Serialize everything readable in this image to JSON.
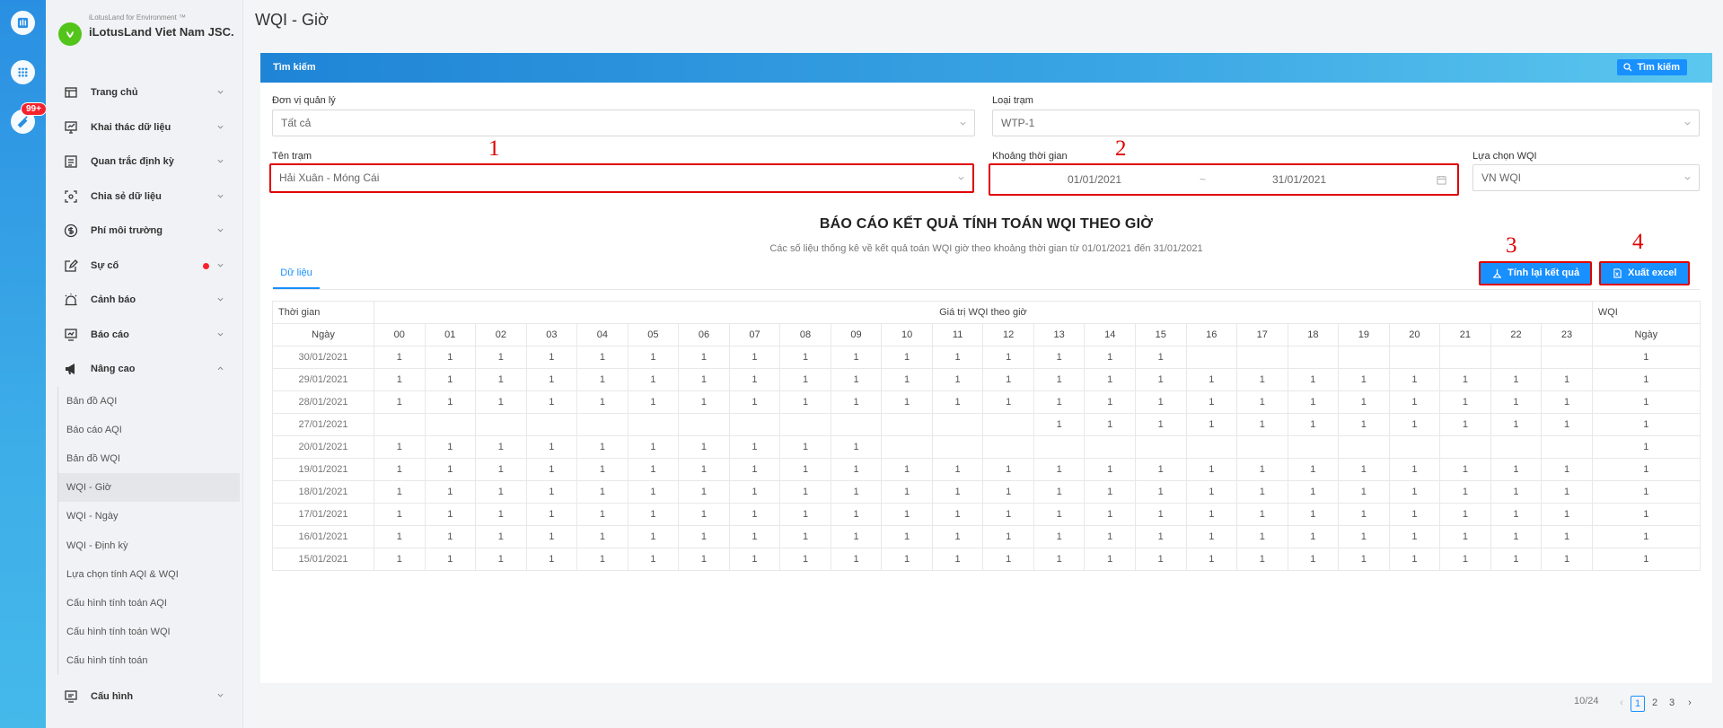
{
  "brand": {
    "subtitle": "iLotusLand for Environment ™",
    "name": "iLotusLand Viet Nam JSC."
  },
  "rail": {
    "badge": "99+"
  },
  "menu": [
    {
      "label": "Trang chủ",
      "icon": "home-icon"
    },
    {
      "label": "Khai thác dữ liệu",
      "icon": "monitor-icon"
    },
    {
      "label": "Quan trắc định kỳ",
      "icon": "calendar-icon"
    },
    {
      "label": "Chia sẻ dữ liệu",
      "icon": "share-icon"
    },
    {
      "label": "Phí môi trường",
      "icon": "dollar-icon"
    },
    {
      "label": "Sự cố",
      "icon": "edit-icon"
    },
    {
      "label": "Cảnh báo",
      "icon": "bell-icon"
    },
    {
      "label": "Báo cáo",
      "icon": "report-icon"
    },
    {
      "label": "Nâng cao",
      "icon": "megaphone-icon"
    }
  ],
  "submenu": [
    "Bản đồ AQI",
    "Báo cáo AQI",
    "Bản đồ WQI",
    "WQI - Giờ",
    "WQI - Ngày",
    "WQI - Định kỳ",
    "Lựa chọn tính AQI & WQI",
    "Cấu hình tính toán AQI",
    "Cấu hình tính toán WQI",
    "Cấu hình tính toán"
  ],
  "menu_bottom": {
    "label": "Cấu hình"
  },
  "page": {
    "title": "WQI - Giờ"
  },
  "search": {
    "bar_label": "Tìm kiếm",
    "button_label": "Tìm kiếm",
    "unit_label": "Đơn vị quản lý",
    "unit_value": "Tất cả",
    "type_label": "Loại trạm",
    "type_value": "WTP-1",
    "station_label": "Tên trạm",
    "station_value": "Hải Xuân - Móng Cái",
    "range_label": "Khoảng thời gian",
    "range_from": "01/01/2021",
    "range_sep": "~",
    "range_to": "31/01/2021",
    "wqi_label": "Lựa chọn WQI",
    "wqi_value": "VN WQI"
  },
  "annotations": [
    "1",
    "2",
    "3",
    "4"
  ],
  "report": {
    "title": "BÁO CÁO KẾT QUẢ TÍNH TOÁN WQI THEO GIỜ",
    "subtitle": "Các số liệu thống kê về kết quả toán WQI giờ theo khoảng thời gian từ 01/01/2021 đến 31/01/2021",
    "tab": "Dữ liệu",
    "recalc_label": "Tính lại kết quả",
    "export_label": "Xuất excel"
  },
  "table": {
    "h_time": "Thời gian",
    "h_values": "Giá trị WQI theo giờ",
    "h_wqi": "WQI",
    "h_day": "Ngày",
    "h_day2": "Ngày",
    "hours": [
      "00",
      "01",
      "02",
      "03",
      "04",
      "05",
      "06",
      "07",
      "08",
      "09",
      "10",
      "11",
      "12",
      "13",
      "14",
      "15",
      "16",
      "17",
      "18",
      "19",
      "20",
      "21",
      "22",
      "23"
    ],
    "rows": [
      {
        "date": "30/01/2021",
        "values": [
          "1",
          "1",
          "1",
          "1",
          "1",
          "1",
          "1",
          "1",
          "1",
          "1",
          "1",
          "1",
          "1",
          "1",
          "1",
          "1",
          "",
          "",
          "",
          "",
          "",
          "",
          "",
          ""
        ],
        "wqi": "1"
      },
      {
        "date": "29/01/2021",
        "values": [
          "1",
          "1",
          "1",
          "1",
          "1",
          "1",
          "1",
          "1",
          "1",
          "1",
          "1",
          "1",
          "1",
          "1",
          "1",
          "1",
          "1",
          "1",
          "1",
          "1",
          "1",
          "1",
          "1",
          "1"
        ],
        "wqi": "1"
      },
      {
        "date": "28/01/2021",
        "values": [
          "1",
          "1",
          "1",
          "1",
          "1",
          "1",
          "1",
          "1",
          "1",
          "1",
          "1",
          "1",
          "1",
          "1",
          "1",
          "1",
          "1",
          "1",
          "1",
          "1",
          "1",
          "1",
          "1",
          "1"
        ],
        "wqi": "1"
      },
      {
        "date": "27/01/2021",
        "values": [
          "",
          "",
          "",
          "",
          "",
          "",
          "",
          "",
          "",
          "",
          "",
          "",
          "",
          "1",
          "1",
          "1",
          "1",
          "1",
          "1",
          "1",
          "1",
          "1",
          "1",
          "1"
        ],
        "wqi": "1"
      },
      {
        "date": "20/01/2021",
        "values": [
          "1",
          "1",
          "1",
          "1",
          "1",
          "1",
          "1",
          "1",
          "1",
          "1",
          "",
          "",
          "",
          "",
          "",
          "",
          "",
          "",
          "",
          "",
          "",
          "",
          "",
          ""
        ],
        "wqi": "1"
      },
      {
        "date": "19/01/2021",
        "values": [
          "1",
          "1",
          "1",
          "1",
          "1",
          "1",
          "1",
          "1",
          "1",
          "1",
          "1",
          "1",
          "1",
          "1",
          "1",
          "1",
          "1",
          "1",
          "1",
          "1",
          "1",
          "1",
          "1",
          "1"
        ],
        "wqi": "1"
      },
      {
        "date": "18/01/2021",
        "values": [
          "1",
          "1",
          "1",
          "1",
          "1",
          "1",
          "1",
          "1",
          "1",
          "1",
          "1",
          "1",
          "1",
          "1",
          "1",
          "1",
          "1",
          "1",
          "1",
          "1",
          "1",
          "1",
          "1",
          "1"
        ],
        "wqi": "1"
      },
      {
        "date": "17/01/2021",
        "values": [
          "1",
          "1",
          "1",
          "1",
          "1",
          "1",
          "1",
          "1",
          "1",
          "1",
          "1",
          "1",
          "1",
          "1",
          "1",
          "1",
          "1",
          "1",
          "1",
          "1",
          "1",
          "1",
          "1",
          "1"
        ],
        "wqi": "1"
      },
      {
        "date": "16/01/2021",
        "values": [
          "1",
          "1",
          "1",
          "1",
          "1",
          "1",
          "1",
          "1",
          "1",
          "1",
          "1",
          "1",
          "1",
          "1",
          "1",
          "1",
          "1",
          "1",
          "1",
          "1",
          "1",
          "1",
          "1",
          "1"
        ],
        "wqi": "1"
      },
      {
        "date": "15/01/2021",
        "values": [
          "1",
          "1",
          "1",
          "1",
          "1",
          "1",
          "1",
          "1",
          "1",
          "1",
          "1",
          "1",
          "1",
          "1",
          "1",
          "1",
          "1",
          "1",
          "1",
          "1",
          "1",
          "1",
          "1",
          "1"
        ],
        "wqi": "1"
      }
    ]
  },
  "pagination": {
    "summary": "10/24",
    "pages": [
      "1",
      "2",
      "3"
    ],
    "current": "1",
    "prev": "‹",
    "next": "›"
  }
}
